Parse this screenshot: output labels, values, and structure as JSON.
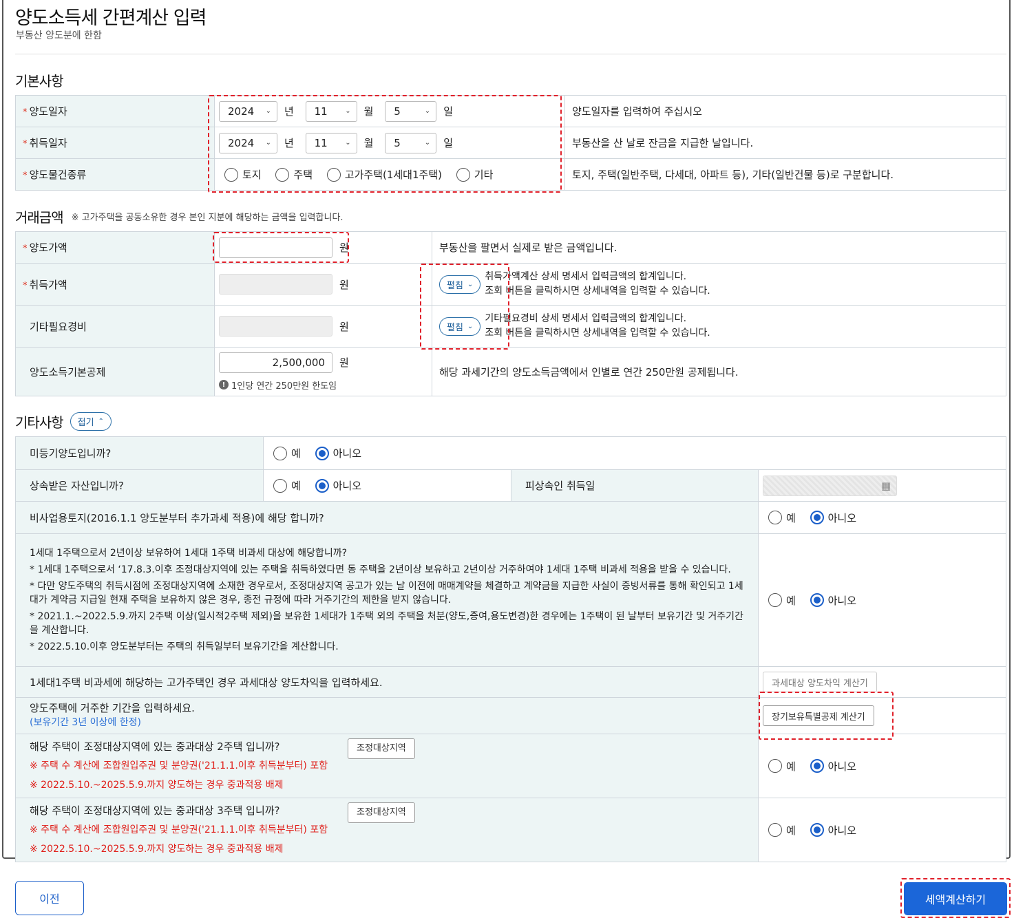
{
  "header": {
    "title": "양도소득세 간편계산 입력",
    "subtitle": "부동산 양도분에 한함"
  },
  "basic": {
    "section_title": "기본사항",
    "transfer_date": {
      "label": "양도일자",
      "year": "2024",
      "month": "11",
      "day": "5",
      "year_unit": "년",
      "month_unit": "월",
      "day_unit": "일",
      "desc": "양도일자를 입력하여 주십시오"
    },
    "acquire_date": {
      "label": "취득일자",
      "year": "2024",
      "month": "11",
      "day": "5",
      "year_unit": "년",
      "month_unit": "월",
      "day_unit": "일",
      "desc": "부동산을 산 날로 잔금을 지급한 날입니다."
    },
    "property_type": {
      "label": "양도물건종류",
      "options": [
        "토지",
        "주택",
        "고가주택(1세대1주택)",
        "기타"
      ],
      "desc": "토지, 주택(일반주택, 다세대, 아파트 등), 기타(일반건물 등)로 구분합니다."
    }
  },
  "amount": {
    "section_title": "거래금액",
    "note": "※ 고가주택을 공동소유한 경우 본인 지분에 해당하는 금액을 입력합니다.",
    "unit": "원",
    "transfer_price": {
      "label": "양도가액",
      "value": "",
      "desc": "부동산을 팔면서 실제로 받은 금액입니다."
    },
    "acquire_price": {
      "label": "취득가액",
      "expand": "펼침",
      "desc1": "취득가액계산 상세 명세서 입력금액의 합계입니다.",
      "desc2": "조회 버튼을 클릭하시면 상세내역을 입력할 수 있습니다."
    },
    "other_cost": {
      "label": "기타필요경비",
      "expand": "펼침",
      "desc1": "기타필요경비 상세 명세서 입력금액의 합계입니다.",
      "desc2": "조회 버튼을 클릭하시면 상세내역을 입력할 수 있습니다."
    },
    "basic_deduction": {
      "label": "양도소득기본공제",
      "value": "2,500,000",
      "info": "1인당 연간 250만원 한도임",
      "desc": "해당 과세기간의 양도소득금액에서 인별로 연간 250만원 공제됩니다."
    }
  },
  "other": {
    "section_title": "기타사항",
    "collapse": "접기",
    "yes": "예",
    "no": "아니오",
    "unregistered": {
      "label": "미등기양도입니까?"
    },
    "inherited": {
      "label": "상속받은 자산입니까?",
      "decedent_label": "피상속인 취득일"
    },
    "non_business_land": {
      "label": "비사업용토지(2016.1.1 양도분부터 추가과세 적용)에 해당 합니까?"
    },
    "one_house": {
      "label": "1세대 1주택으로서 2년이상 보유하여 1세대 1주택 비과세 대상에 해당합니까?",
      "notes": [
        "* 1세대 1주택으로서 ‘17.8.3.이후 조정대상지역에 있는 주택을 취득하였다면 동 주택을 2년이상 보유하고 2년이상 거주하여야 1세대 1주택 비과세 적용을 받을 수 있습니다.",
        "* 다만 양도주택의 취득시점에 조정대상지역에 소재한 경우로서, 조정대상지역 공고가 있는 날 이전에 매매계약을 체결하고 계약금을 지급한 사실이 증빙서류를 통해 확인되고 1세대가 계약금 지급일 현재 주택을 보유하지 않은 경우, 종전 규정에 따라 거주기간의 제한을 받지 않습니다.",
        "* 2021.1.~2022.5.9.까지 2주택 이상(일시적2주택 제외)을 보유한 1세대가 1주택 외의 주택을 처분(양도,증여,용도변경)한 경우에는 1주택이 된 날부터 보유기간 및 거주기간을 계산합니다.",
        "* 2022.5.10.이후 양도분부터는 주택의 취득일부터 보유기간을 계산합니다."
      ]
    },
    "luxury_gain": {
      "label": "1세대1주택 비과세에 해당하는 고가주택인 경우 과세대상 양도차익을 입력하세요.",
      "button": "과세대상 양도차익 계산기"
    },
    "residence": {
      "label": "양도주택에 거주한 기간을 입력하세요.",
      "note": "(보유기간 3년 이상에 한정)",
      "button": "장기보유특별공제 계산기"
    },
    "heavy2": {
      "label": "해당 주택이 조정대상지역에 있는 중과대상 2주택 입니까?",
      "button": "조정대상지역",
      "red1": "※ 주택 수 계산에 조합원입주권 및 분양권('21.1.1.이후 취득분부터) 포함",
      "red2": "※ 2022.5.10.~2025.5.9.까지 양도하는 경우 중과적용 배제"
    },
    "heavy3": {
      "label": "해당 주택이 조정대상지역에 있는 중과대상 3주택 입니까?",
      "button": "조정대상지역",
      "red1": "※ 주택 수 계산에 조합원입주권 및 분양권('21.1.1.이후 취득분부터) 포함",
      "red2": "※ 2022.5.10.~2025.5.9.까지 양도하는 경우 중과적용 배제"
    }
  },
  "footer": {
    "prev": "이전",
    "calculate": "세액계산하기"
  },
  "colors": {
    "accent": "#1b66d9",
    "label_bg": "#edf5f5",
    "required": "#d32222",
    "warning": "#e0201b",
    "highlight": "#e0202a"
  }
}
